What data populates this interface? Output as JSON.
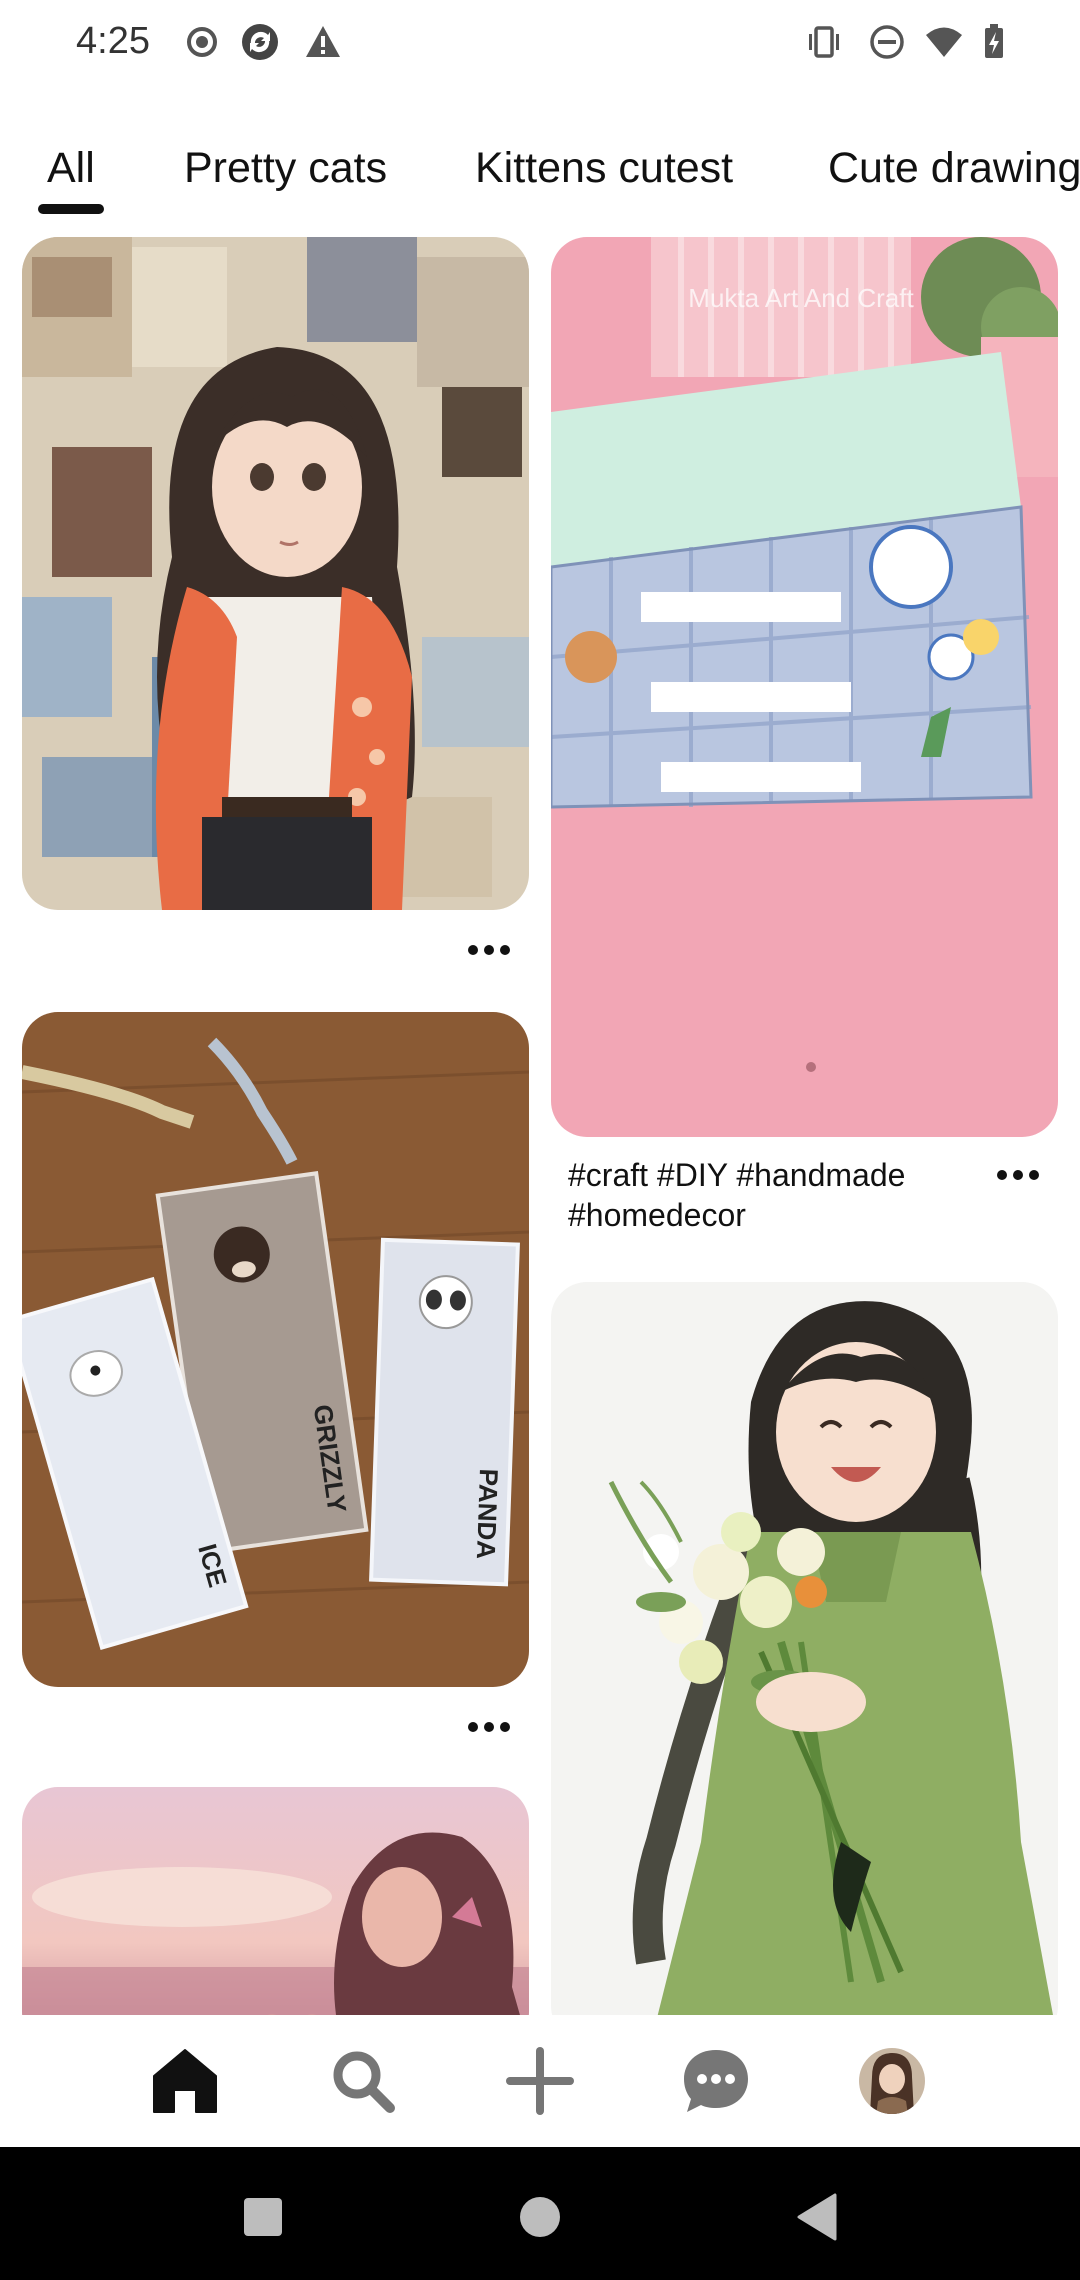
{
  "status_bar": {
    "time": "4:25",
    "left_icons": [
      "record-icon",
      "sync-icon",
      "warning-icon"
    ],
    "right_icons": [
      "vibrate-icon",
      "dnd-icon",
      "wifi-icon",
      "battery-icon"
    ]
  },
  "tabs": [
    {
      "label": "All",
      "selected": true
    },
    {
      "label": "Pretty cats",
      "selected": false
    },
    {
      "label": "Kittens cutest",
      "selected": false
    },
    {
      "label": "Cute drawing",
      "selected": false
    }
  ],
  "pins": {
    "anime_girl_collage": {
      "image": "anime girl with collage background"
    },
    "craft_drawers": {
      "image": "handmade paper drawers",
      "caption": "#craft #DIY #handmade #homedecor",
      "watermark": "Mukta Art And Craft"
    },
    "bookmarks": {
      "image": "bear bookmarks",
      "labels": [
        "GRIZZLY",
        "PANDA",
        "ICE"
      ]
    },
    "flower_girl": {
      "image": "smiling girl holding flower bouquet"
    },
    "sunset_girl": {
      "image": "girl at sunset"
    }
  },
  "bottom_nav": {
    "items": [
      "home-icon",
      "search-icon",
      "create-icon",
      "messages-icon",
      "profile-avatar"
    ],
    "active": "home-icon"
  },
  "colors": {
    "text": "#111111",
    "background": "#ffffff",
    "system_nav": "#000000"
  }
}
